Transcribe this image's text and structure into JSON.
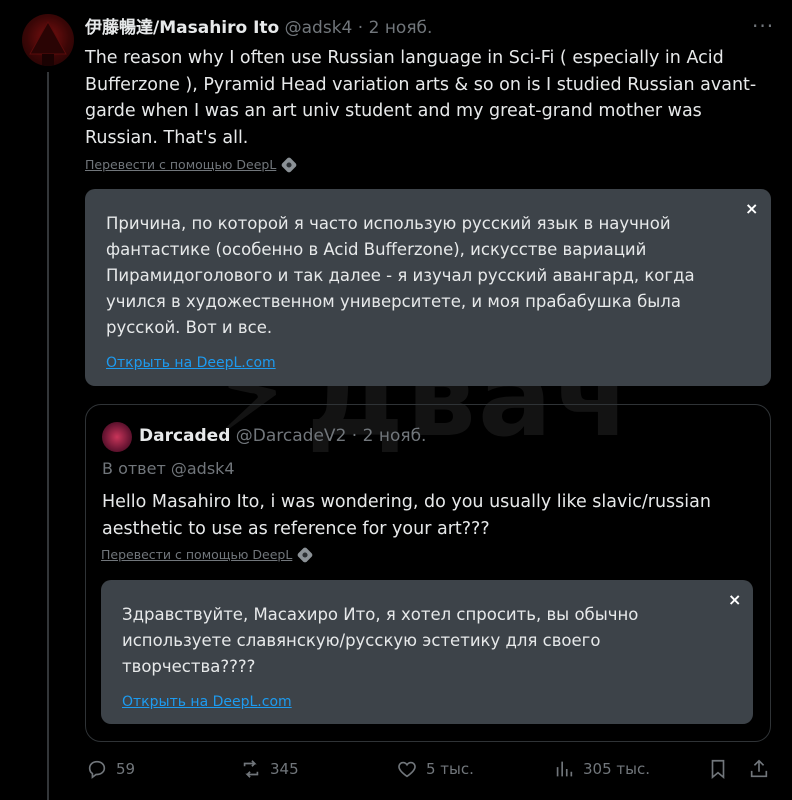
{
  "tweet": {
    "author_name": "伊藤暢達/Masahiro Ito",
    "handle": "@adsk4",
    "separator": "·",
    "date": "2 нояб.",
    "more_label": "···",
    "text": "The reason why I often use Russian language in Sci-Fi ( especially in Acid Bufferzone ), Pyramid Head variation arts & so on is I studied Russian avant-garde when I was an art univ student and my great-grand mother was Russian. That's all.",
    "translate_label": "Перевести с помощью DeepL",
    "translation": {
      "text": "Причина, по которой я часто использую русский язык в научной фантастике (особенно в Acid Bufferzone), искусстве вариаций Пирамидоголового и так далее - я изучал русский авангард, когда учился в художественном университете, и моя прабабушка была русской. Вот и все.",
      "close_label": "×",
      "open_label": "Открыть на DeepL.com"
    }
  },
  "quoted": {
    "author_name": "Darcaded",
    "handle": "@DarcadeV2",
    "separator": "·",
    "date": "2 нояб.",
    "reply_to": "В ответ @adsk4",
    "text": "Hello Masahiro Ito, i was wondering, do you usually like slavic/russian aesthetic to use as reference for your art???",
    "translate_label": "Перевести с помощью DeepL",
    "translation": {
      "text": "Здравствуйте, Масахиро Ито, я хотел спросить, вы обычно используете славянскую/русскую эстетику для своего творчества????",
      "close_label": "×",
      "open_label": "Открыть на DeepL.com"
    }
  },
  "watermark": "Двач",
  "actions": {
    "replies": "59",
    "reposts": "345",
    "likes": "5 тыс.",
    "views": "305 тыс."
  },
  "icons": {
    "reply": "reply-icon",
    "repost": "repost-icon",
    "like": "heart-icon",
    "views": "views-icon",
    "bookmark": "bookmark-icon",
    "share": "share-icon"
  },
  "colors": {
    "background": "#000000",
    "text": "#e7e9ea",
    "muted": "#71767b",
    "link": "#1d9bf0",
    "translation_box": "#3d4349"
  }
}
